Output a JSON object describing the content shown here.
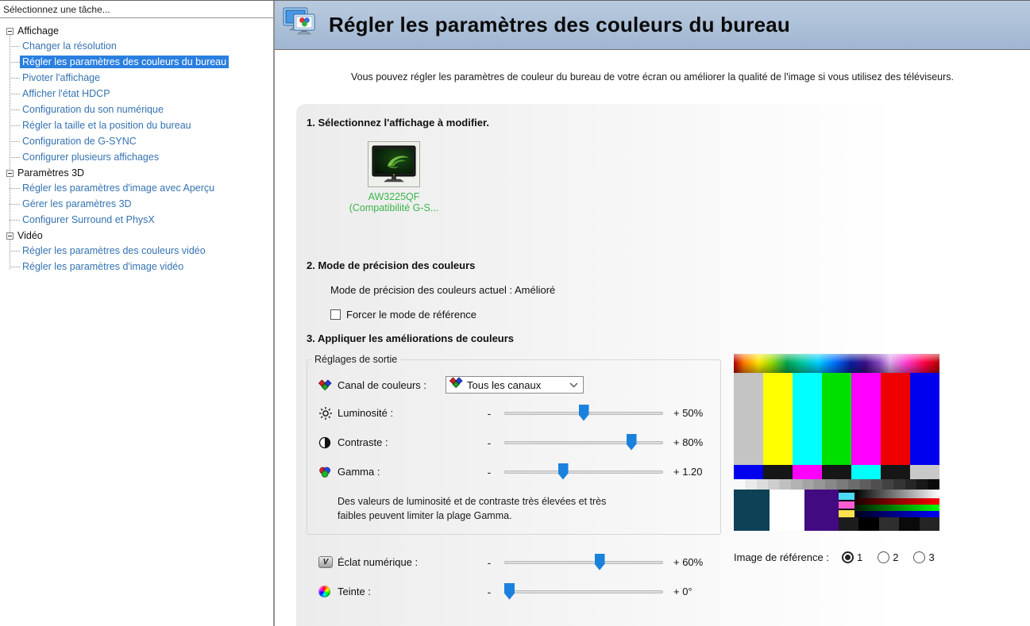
{
  "sidebar": {
    "header": "Sélectionnez une tâche...",
    "selected": "Régler les paramètres des couleurs du bureau",
    "tree": [
      {
        "label": "Affichage",
        "children": [
          "Changer la résolution",
          "Régler les paramètres des couleurs du bureau",
          "Pivoter l'affichage",
          "Afficher l'état HDCP",
          "Configuration du son numérique",
          "Régler la taille et la position du bureau",
          "Configuration de G-SYNC",
          "Configurer plusieurs affichages"
        ]
      },
      {
        "label": "Paramètres 3D",
        "children": [
          "Régler les paramètres d'image avec Aperçu",
          "Gérer les paramètres 3D",
          "Configurer Surround et PhysX"
        ]
      },
      {
        "label": "Vidéo",
        "children": [
          "Régler les paramètres des couleurs vidéo",
          "Régler les paramètres d'image vidéo"
        ]
      }
    ]
  },
  "header": {
    "title": "Régler les paramètres des couleurs du bureau",
    "icon": "desktop-color-settings-icon"
  },
  "intro": "Vous pouvez régler les paramètres de couleur du bureau de votre écran ou améliorer la qualité de l'image si vous utilisez des téléviseurs.",
  "steps": {
    "step1": "1. Sélectionnez l'affichage à modifier.",
    "step2": "2. Mode de précision des couleurs",
    "step3": "3. Appliquer les améliorations de couleurs"
  },
  "display": {
    "name": "AW3225QF",
    "subname": "(Compatibilité G-S..."
  },
  "mode": {
    "current": "Mode de précision des couleurs actuel : Amélioré",
    "checkbox_label": "Forcer le mode de référence",
    "checked": false
  },
  "output": {
    "legend": "Réglages de sortie",
    "channel_label": "Canal de couleurs :",
    "channel_value": "Tous les canaux",
    "sliders": [
      {
        "id": "brightness",
        "icon": "brightness-icon",
        "label": "Luminosité :",
        "minus": "-",
        "value": "+ 50%",
        "pos": 50
      },
      {
        "id": "contrast",
        "icon": "contrast-icon",
        "label": "Contraste :",
        "minus": "-",
        "value": "+ 80%",
        "pos": 80
      },
      {
        "id": "gamma",
        "icon": "gamma-icon",
        "label": "Gamma :",
        "minus": "-",
        "value": "+ 1.20",
        "pos": 37
      }
    ],
    "note": "Des valeurs de luminosité et de contraste très élevées et très faibles peuvent limiter la plage Gamma."
  },
  "extra_sliders": [
    {
      "id": "vibrance",
      "icon": "digital-vibrance-icon",
      "label": "Éclat numérique :",
      "minus": "-",
      "value": "+ 60%",
      "pos": 60
    },
    {
      "id": "hue",
      "icon": "hue-icon",
      "label": "Teinte :",
      "minus": "-",
      "value": "+ 0°",
      "pos": 0
    }
  ],
  "reference": {
    "label": "Image de référence :",
    "options": [
      "1",
      "2",
      "3"
    ],
    "selected": "1"
  },
  "pattern": {
    "bars": [
      "#c4c4c4",
      "#ffff00",
      "#00ffff",
      "#00e000",
      "#ff00ff",
      "#ee0000",
      "#0000ee"
    ],
    "mini": [
      "#0000ee",
      "#161616",
      "#ff00ff",
      "#161616",
      "#00ffff",
      "#161616",
      "#c8c8c8"
    ],
    "bottom": {
      "teal": "#0e4156",
      "white": "#ffffff",
      "purple": "#410a80"
    },
    "swatches": [
      "#4dd9f6",
      "#ff5cd0",
      "#ffe14d"
    ],
    "darkrow": [
      "#1c1c1c",
      "#000000",
      "#2e2e2e",
      "#0a0a0a",
      "#242424"
    ]
  },
  "colors": {
    "accent": "#1a82dd",
    "selection": "#2a7fe0",
    "link": "#3573b1",
    "green_label": "#3cb54a"
  }
}
